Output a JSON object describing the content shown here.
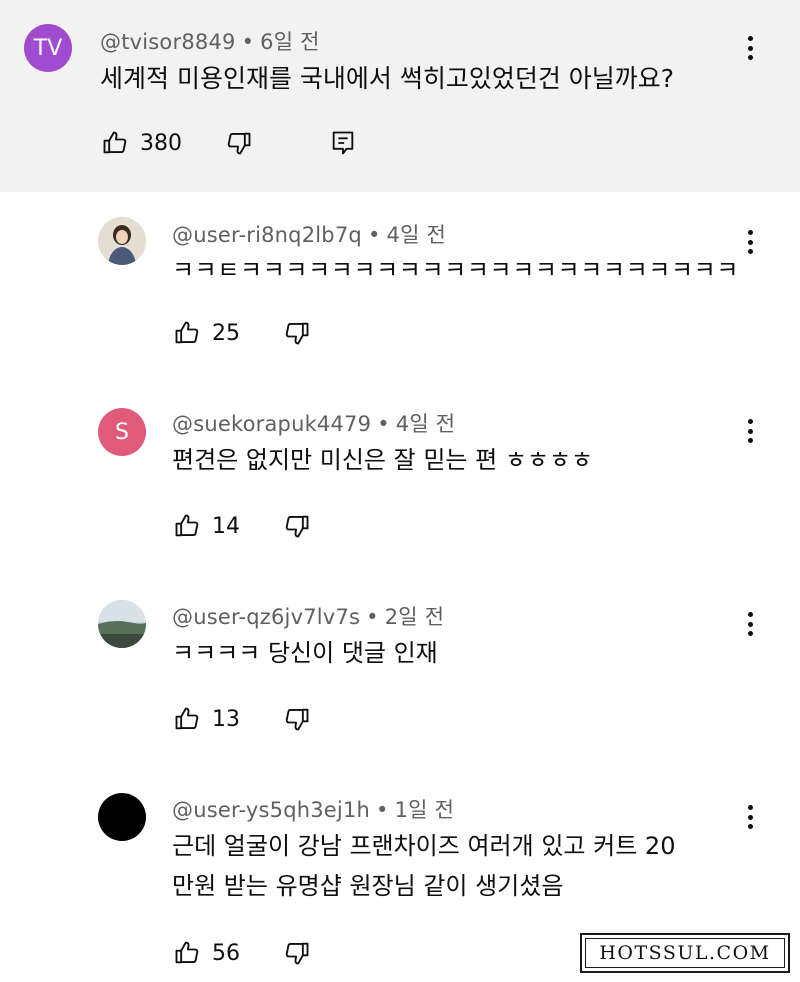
{
  "comments": [
    {
      "author": "@tvisor8849",
      "time": "6일 전",
      "avatar_text": "TV",
      "avatar_color": "#a14bd1",
      "lines": [
        "세계적 미용인재를 국내에서 썩히고있었던건 아닐까요?"
      ],
      "likes": "380",
      "icons": [
        "thumb-up-icon",
        "thumb-down-icon",
        "reply-icon",
        "more-vert-icon"
      ]
    },
    {
      "author": "@user-ri8nq2lb7q",
      "time": "4일 전",
      "avatar_text": "",
      "lines": [
        "ㅋㅋㅌㅋㅋㅋㅋㅋㅋㅋㅋㅋㅋㅋㅋㅋㅋㅋㅋㅋㅋㅋㅋㅋㅋ"
      ],
      "likes": "25"
    },
    {
      "author": "@suekorapuk4479",
      "time": "4일 전",
      "avatar_text": "S",
      "avatar_color": "#e05a7a",
      "lines": [
        "편견은 없지만 미신은 잘 믿는 편 ㅎㅎㅎㅎ"
      ],
      "likes": "14"
    },
    {
      "author": "@user-qz6jv7lv7s",
      "time": "2일 전",
      "avatar_text": "",
      "lines": [
        "ㅋㅋㅋㅋ 당신이 댓글 인재"
      ],
      "likes": "13"
    },
    {
      "author": "@user-ys5qh3ej1h",
      "time": "1일 전",
      "avatar_text": "",
      "avatar_color": "#000000",
      "lines": [
        "근데 얼굴이 강남 프랜차이즈 여러개 있고 커트 20",
        "만원 받는 유명샵 원장님 같이 생기셨음"
      ],
      "likes": "56"
    }
  ],
  "watermark": "HOTSSUL.COM",
  "colors": {
    "top_bg": "#f2f2f2",
    "meta": "#606060",
    "text": "#0f0f0f"
  }
}
